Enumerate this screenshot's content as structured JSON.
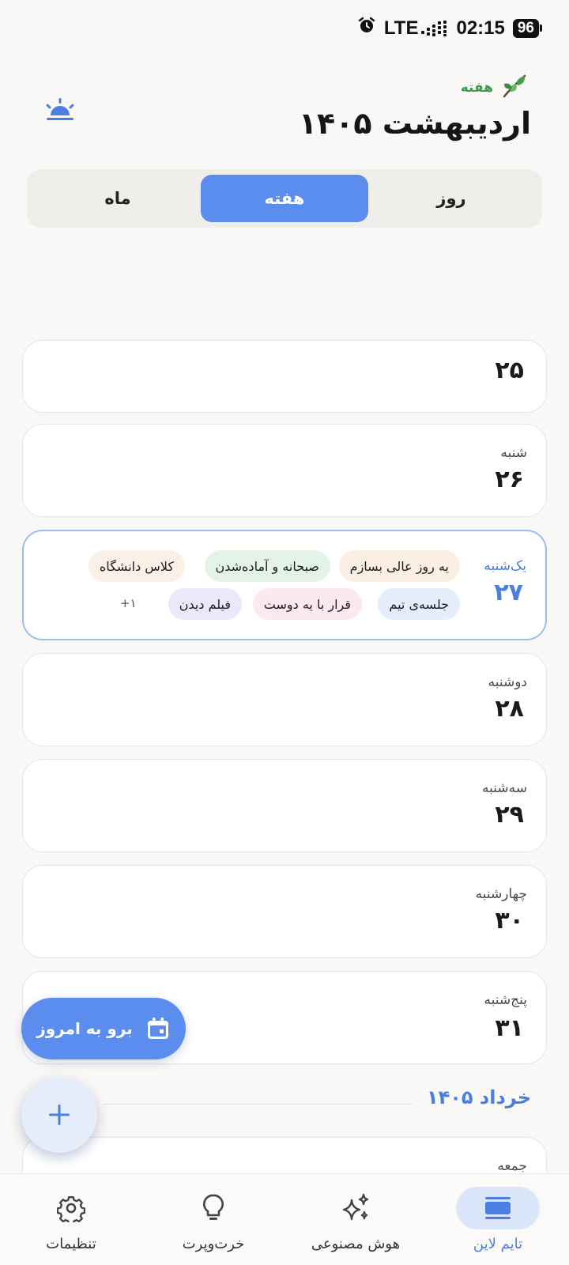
{
  "status_bar": {
    "network": "LTE",
    "time": "02:15",
    "battery": "96"
  },
  "header": {
    "week_tag": "هفته",
    "month_title": "اردیبهشت ۱۴۰۵"
  },
  "view_switch": {
    "day": "روز",
    "week": "هفته",
    "month": "ماه",
    "selected": "week"
  },
  "days": [
    {
      "name": "",
      "number": "۲۵"
    },
    {
      "name": "شنبه",
      "number": "۲۶"
    },
    {
      "name": "یک‌شنبه",
      "number": "۲۷",
      "today": true,
      "events": [
        {
          "title": "یه روز عالی بسازم",
          "color": "#fbefe3"
        },
        {
          "title": "صبحانه و آماده‌شدن",
          "color": "#e4f3e8"
        },
        {
          "title": "کلاس دانشگاه",
          "color": "#fbf0e6"
        },
        {
          "title": "جلسه‌ی تیم",
          "color": "#e4edfb"
        },
        {
          "title": "قرار با یه دوست",
          "color": "#fbe9ee"
        },
        {
          "title": "فیلم دیدن",
          "color": "#ece8fb"
        }
      ],
      "more": "+۱"
    },
    {
      "name": "دوشنبه",
      "number": "۲۸"
    },
    {
      "name": "سه‌شنبه",
      "number": "۲۹"
    },
    {
      "name": "چهارشنبه",
      "number": "۳۰"
    },
    {
      "name": "پنج‌شنبه",
      "number": "۳۱"
    },
    {
      "name": "جمعه",
      "number": ""
    }
  ],
  "next_month_label": "خرداد ۱۴۰۵",
  "fab": {
    "today_label": "برو به امروز"
  },
  "nav": {
    "timeline": "تایم لاین",
    "ai": "هوش مصنوعی",
    "misc": "خرت‌وپرت",
    "settings": "تنظیمات",
    "active": "timeline"
  },
  "colors": {
    "accent": "#5b8def",
    "accent_text": "#4a7ee0",
    "week_tag": "#3e9a4f"
  }
}
